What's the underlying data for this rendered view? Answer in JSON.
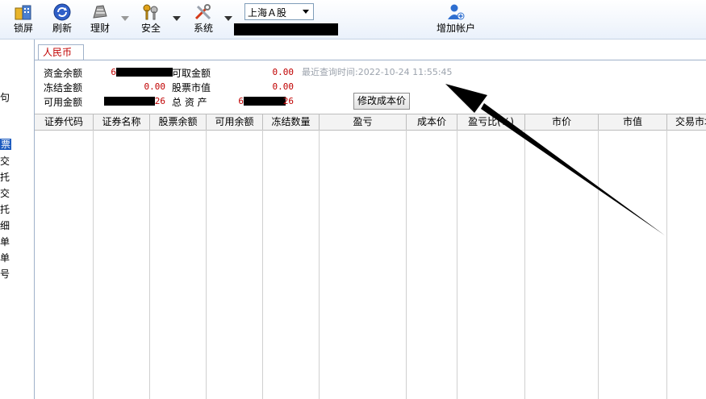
{
  "toolbar": {
    "lock_label": "锁屏",
    "refresh_label": "刷新",
    "finance_label": "理财",
    "security_label": "安全",
    "system_label": "系统",
    "market_select": "上海Ａ股",
    "add_account_label": "增加帐户"
  },
  "left_panel": {
    "items": [
      "句",
      "票",
      "交",
      "托",
      "交",
      "托",
      "细",
      "单",
      "单",
      "号"
    ]
  },
  "tab": {
    "label": "人民币"
  },
  "summary": {
    "fund_balance_label": "资金余额",
    "fund_balance_value": "6",
    "withdrawable_label": "可取金额",
    "withdrawable_value": "0.00",
    "frozen_label": "冻结金额",
    "frozen_value": "0.00",
    "stock_value_label": "股票市值",
    "stock_value_value": "0.00",
    "available_label": "可用金额",
    "available_value": "26",
    "total_assets_label": "总 资 产",
    "total_assets_value_a": "6",
    "total_assets_value_b": "26",
    "last_query": "最近查询时间:2022-10-24 11:55:45",
    "edit_cost_button": "修改成本价"
  },
  "table": {
    "columns": [
      "证券代码",
      "证券名称",
      "股票余额",
      "可用余额",
      "冻结数量",
      "盈亏",
      "成本价",
      "盈亏比(%)",
      "市价",
      "市值",
      "交易市场"
    ]
  },
  "colors": {
    "accent": "#c00000",
    "selected": "#1d5bbf",
    "annotation_arrow": "#000000"
  }
}
